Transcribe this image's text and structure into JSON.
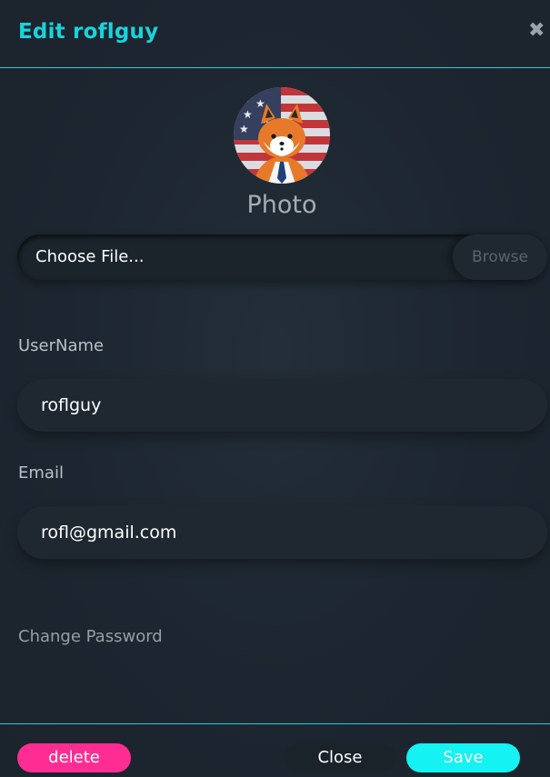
{
  "modal": {
    "title": "Edit roflguy",
    "close_icon": "close-icon",
    "accent_color": "#19d3dc"
  },
  "photo": {
    "label": "Photo",
    "avatar": "fox-avatar-with-flag"
  },
  "file": {
    "placeholder": "Choose File...",
    "browse_label": "Browse"
  },
  "username": {
    "label": "UserName",
    "value": "roflguy"
  },
  "email": {
    "label": "Email",
    "value": "rofl@gmail.com"
  },
  "change_password": {
    "label": "Change Password"
  },
  "footer": {
    "delete_label": "delete",
    "close_label": "Close",
    "save_label": "Save",
    "delete_color": "#ff2d93",
    "save_color": "#14f2f2"
  }
}
